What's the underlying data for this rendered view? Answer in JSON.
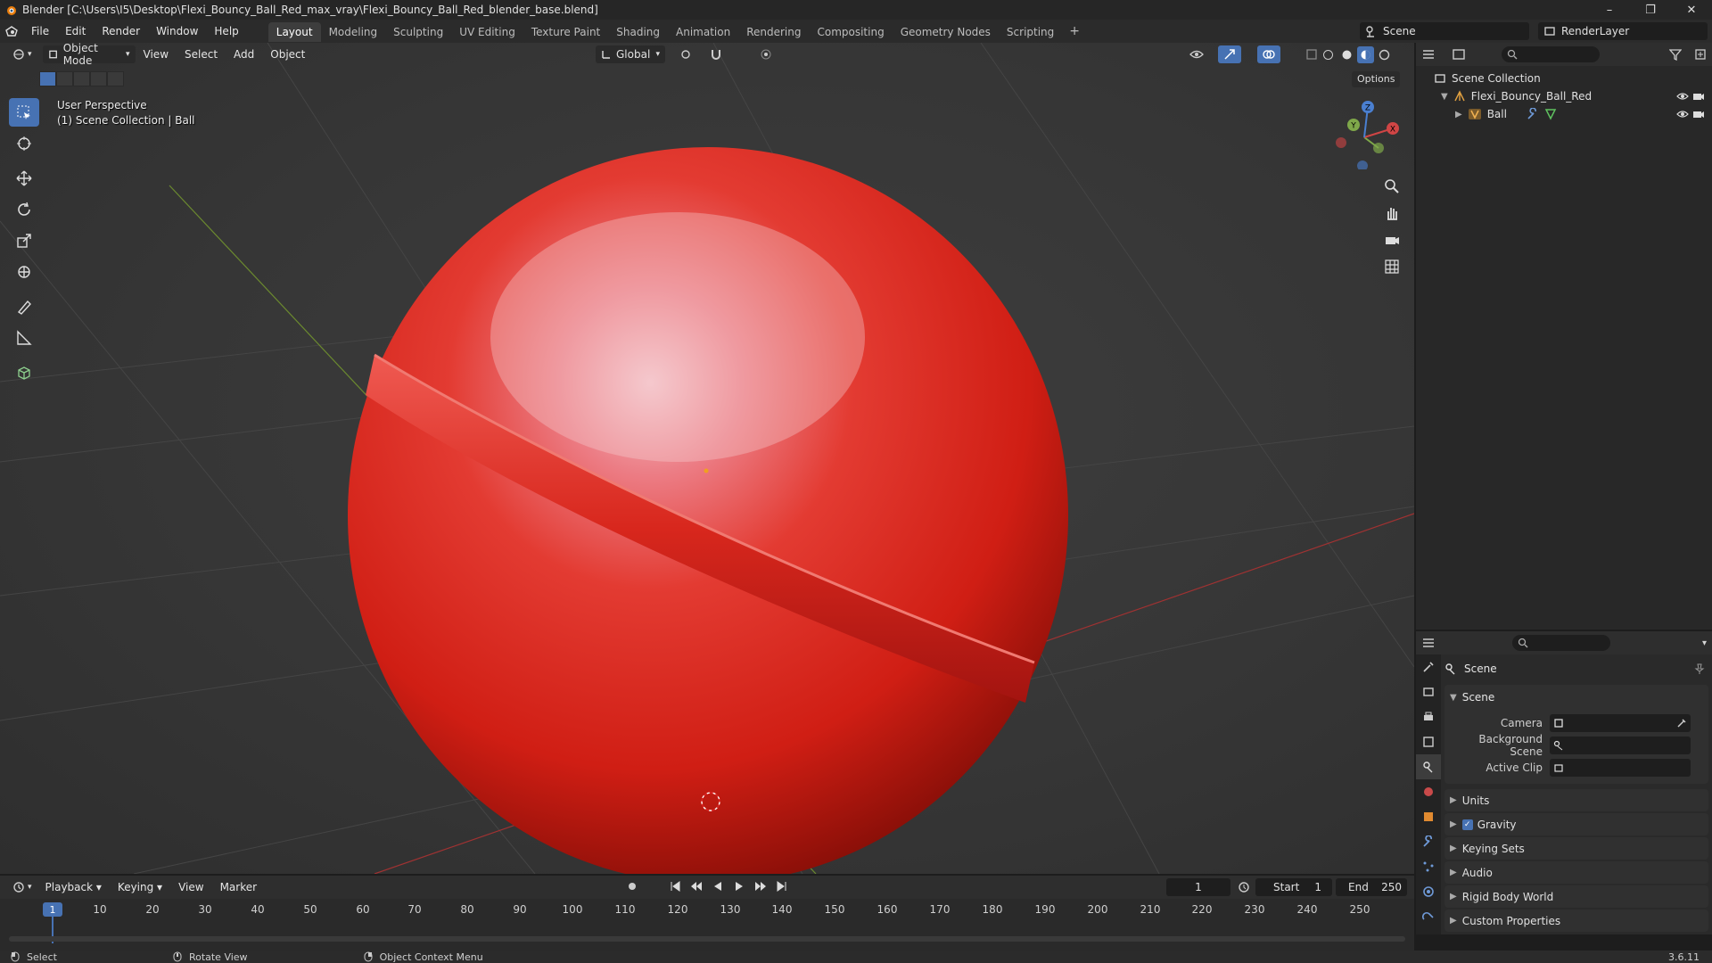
{
  "window": {
    "title": "Blender [C:\\Users\\I5\\Desktop\\Flexi_Bouncy_Ball_Red_max_vray\\Flexi_Bouncy_Ball_Red_blender_base.blend]",
    "minimize": "–",
    "restore": "❐",
    "close": "✕"
  },
  "menu": [
    "File",
    "Edit",
    "Render",
    "Window",
    "Help"
  ],
  "workspaces": [
    "Layout",
    "Modeling",
    "Sculpting",
    "UV Editing",
    "Texture Paint",
    "Shading",
    "Animation",
    "Rendering",
    "Compositing",
    "Geometry Nodes",
    "Scripting"
  ],
  "workspace_add": "+",
  "scene_selector": "Scene",
  "render_layer": "RenderLayer",
  "viewport": {
    "mode": "Object Mode",
    "menus": [
      "View",
      "Select",
      "Add",
      "Object"
    ],
    "transform_orientation": "Global",
    "options_label": "Options",
    "info_line1": "User Perspective",
    "info_line2": "(1) Scene Collection | Ball",
    "axis_labels": {
      "x": "X",
      "y": "Y",
      "z": "Z"
    }
  },
  "outliner": {
    "rows": [
      "Scene Collection",
      "Flexi_Bouncy_Ball_Red",
      "Ball"
    ]
  },
  "properties": {
    "context": "Scene",
    "panel": "Scene",
    "fields": {
      "camera_label": "Camera",
      "bg_scene_label": "Background Scene",
      "active_clip_label": "Active Clip"
    },
    "collapsed_panels": [
      "Units",
      "Gravity",
      "Keying Sets",
      "Audio",
      "Rigid Body World",
      "Custom Properties"
    ],
    "gravity_checked": true
  },
  "timeline": {
    "menus": [
      "Playback",
      "Keying",
      "View",
      "Marker"
    ],
    "current_frame": "1",
    "start_label": "Start",
    "start": "1",
    "end_label": "End",
    "end": "250",
    "ruler": [
      "10",
      "20",
      "30",
      "40",
      "50",
      "60",
      "70",
      "80",
      "90",
      "100",
      "110",
      "120",
      "130",
      "140",
      "150",
      "160",
      "170",
      "180",
      "190",
      "200",
      "210",
      "220",
      "230",
      "240",
      "250"
    ],
    "cursor_label": "1"
  },
  "status": {
    "left": "Select",
    "middle": "Rotate View",
    "right": "Object Context Menu",
    "version": "3.6.11"
  },
  "colors": {
    "accent": "#4772b3",
    "ball": "#e0241c"
  }
}
